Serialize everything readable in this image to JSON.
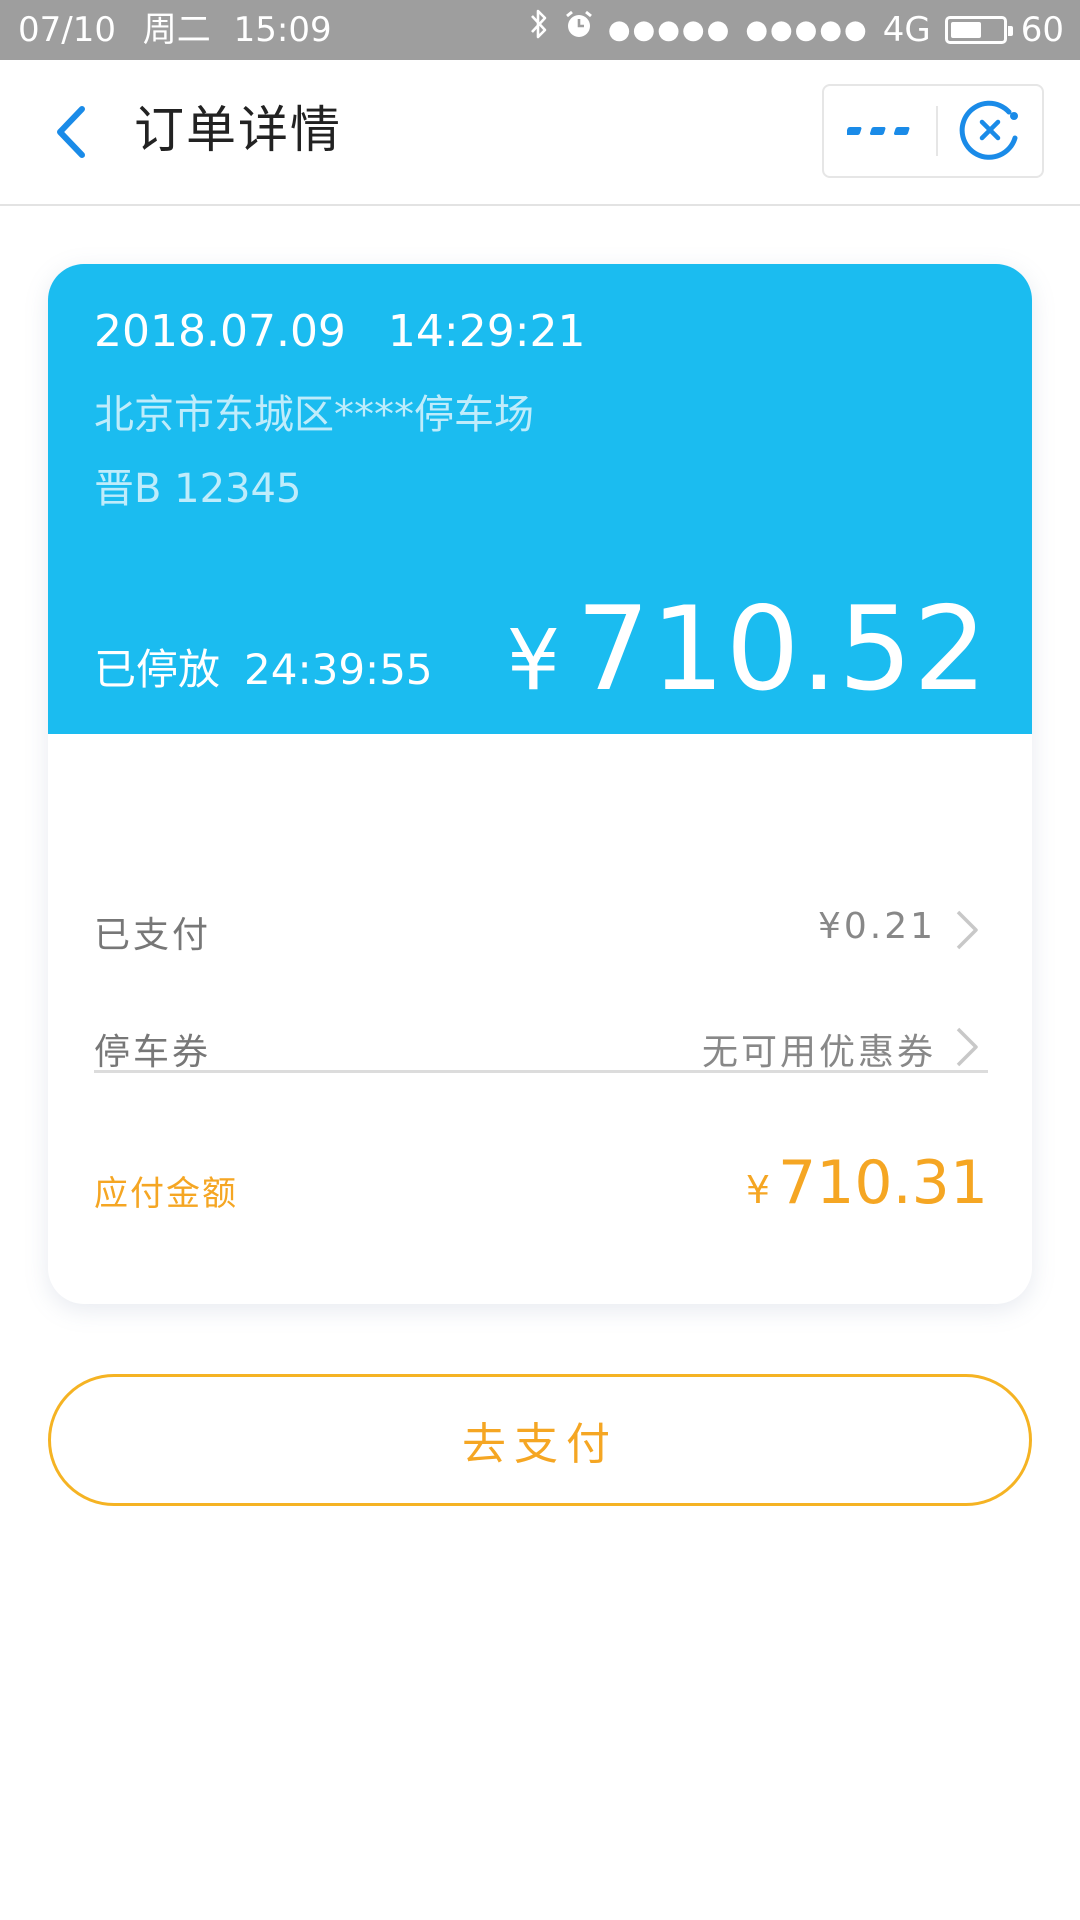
{
  "status_bar": {
    "date": "07/10",
    "weekday": "周二",
    "time": "15:09",
    "signal_1": "●●●●●",
    "signal_2": "●●●●●",
    "network": "4G",
    "battery": "60",
    "battery_level": 0.6
  },
  "nav": {
    "title": "订单详情"
  },
  "order": {
    "date": "2018.07.09",
    "time": "14:29:21",
    "address": "北京市东城区****停车场",
    "plate": "晋B 12345",
    "parked_label": "已停放",
    "parked_duration": "24:39:55",
    "currency": "¥",
    "total": "710.52"
  },
  "details": {
    "paid_label": "已支付",
    "paid_value": "¥0.21",
    "coupon_label": "停车券",
    "coupon_value": "无可用优惠券",
    "due_label": "应付金额",
    "due_currency": "¥",
    "due_amount": "710.31"
  },
  "actions": {
    "pay_label": "去支付"
  },
  "colors": {
    "accent_blue": "#1bbcf0",
    "accent_orange": "#f5a623",
    "nav_blue": "#1a8be8"
  }
}
